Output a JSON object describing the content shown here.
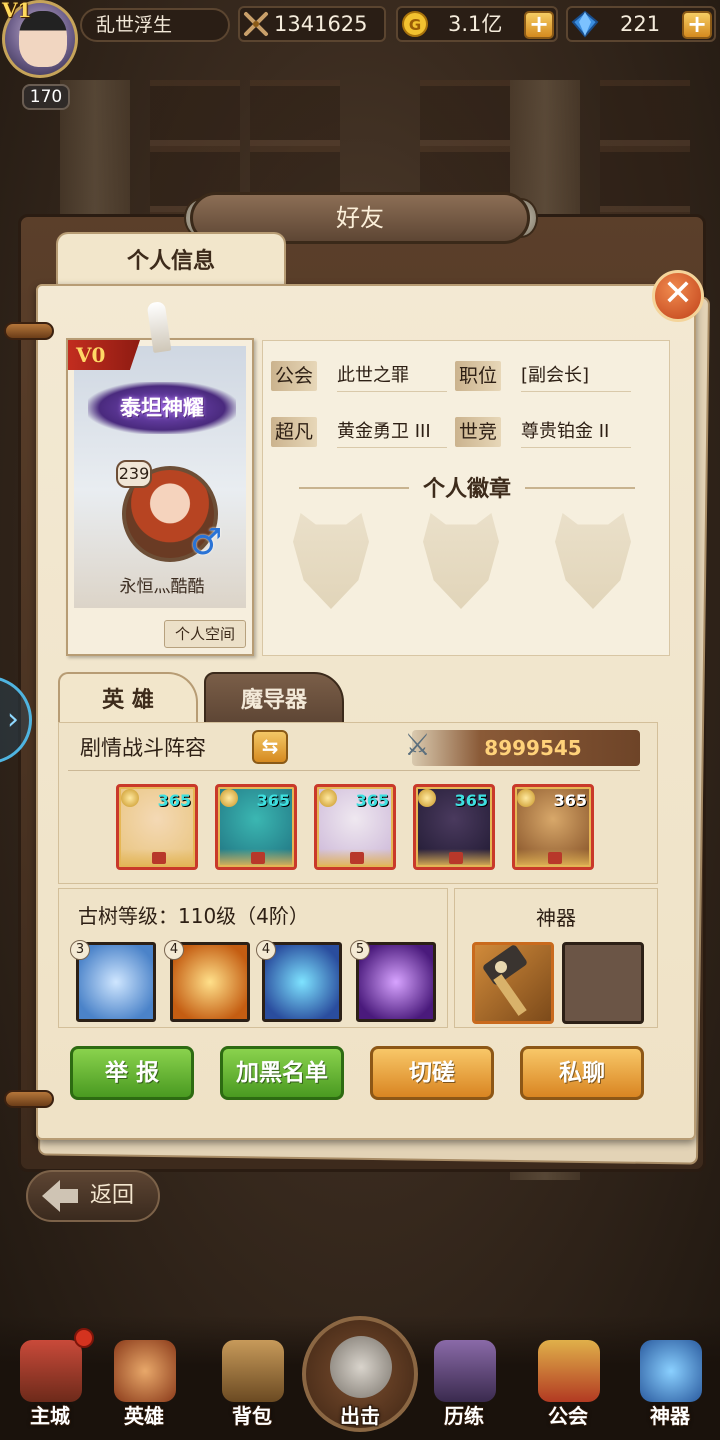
{
  "player": {
    "vip": "V1",
    "level": "170",
    "name": "乱世浮生"
  },
  "resources": {
    "power": "1341625",
    "gold": "3.1亿",
    "gems": "221"
  },
  "dialog": {
    "title": "好友",
    "tab": "个人信息",
    "close_glyph": "✕"
  },
  "profile": {
    "vip_badge": "V0",
    "banner_text": "泰坦神耀",
    "level": "239",
    "gender_glyph": "♂",
    "name": "永恒灬酷酷",
    "space_button": "个人空间"
  },
  "info": {
    "rows": [
      {
        "label": "公会",
        "value": "此世之罪"
      },
      {
        "label": "职位",
        "value": "[副会长]"
      },
      {
        "label": "超凡",
        "value": "黄金勇卫 III"
      },
      {
        "label": "世竞",
        "value": "尊贵铂金 II"
      }
    ],
    "badge_title": "个人徽章"
  },
  "hero_tabs": {
    "heroes": "英 雄",
    "mage": "魔导器"
  },
  "lineup": {
    "label": "剧情战斗阵容",
    "power": "8999545",
    "heroes": [
      {
        "level": "365",
        "colors": [
          "#f4d9b5",
          "#e8c37a"
        ]
      },
      {
        "level": "365",
        "colors": [
          "#3bb7b2",
          "#1e6e7e"
        ]
      },
      {
        "level": "365",
        "colors": [
          "#efe8f0",
          "#c9b3d6"
        ]
      },
      {
        "level": "365",
        "colors": [
          "#4a3a5e",
          "#1e1830"
        ]
      },
      {
        "level": "365",
        "colors": [
          "#d8a86a",
          "#7e4a22"
        ]
      }
    ]
  },
  "tree": {
    "label": "古树等级：110级（4阶）",
    "skills": [
      {
        "num": "3",
        "colors": [
          "#cfe6ff",
          "#4b83c9"
        ]
      },
      {
        "num": "4",
        "colors": [
          "#ffe08a",
          "#c45d12"
        ]
      },
      {
        "num": "4",
        "colors": [
          "#7ee3ff",
          "#2a4d9e"
        ]
      },
      {
        "num": "5",
        "colors": [
          "#d7a3ff",
          "#4a1a7c"
        ]
      }
    ]
  },
  "artifact": {
    "label": "神器"
  },
  "actions": {
    "report": "举 报",
    "blacklist": "加黑名单",
    "spar": "切磋",
    "chat": "私聊"
  },
  "back": {
    "label": "返回"
  },
  "side_handle": "›",
  "nav": [
    {
      "label": "主城"
    },
    {
      "label": "英雄"
    },
    {
      "label": "背包"
    },
    {
      "label": "出击"
    },
    {
      "label": "历练"
    },
    {
      "label": "公会"
    },
    {
      "label": "神器"
    }
  ]
}
